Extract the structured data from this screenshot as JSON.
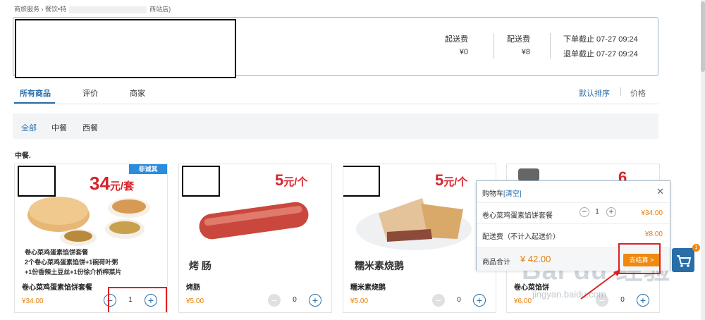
{
  "breadcrumb": {
    "part1": "商旅服务 › 餐饮•特",
    "part2": "西站店)"
  },
  "shop": {
    "fees": [
      {
        "label": "起送费",
        "value": "¥0"
      },
      {
        "label": "配送费",
        "value": "¥8"
      }
    ],
    "deadlines": [
      {
        "label": "下单截止 07-27 09:24"
      },
      {
        "label": "退单截止 07-27 09:24"
      }
    ]
  },
  "tabs": [
    {
      "label": "所有商品"
    },
    {
      "label": "评价"
    },
    {
      "label": "商家"
    }
  ],
  "sort": {
    "default": "默认排序",
    "price": "价格"
  },
  "filters": [
    {
      "label": "全部"
    },
    {
      "label": "中餐"
    },
    {
      "label": "西餐"
    }
  ],
  "section_title": "中餐.",
  "products": [
    {
      "name": "卷心菜鸡蛋素馅饼套餐",
      "price": "¥34.00",
      "qty": "1",
      "promo_num": "34",
      "promo_unit": "元/套",
      "badge": "非诚其",
      "desc": [
        "卷心菜鸡蛋素馅饼套餐",
        "2个卷心菜鸡蛋素馅饼+1碗荷叶粥",
        "+1份香辣土豆丝+1份徐介桥榨菜片"
      ]
    },
    {
      "name": "烤肠",
      "price": "¥5.00",
      "qty": "0",
      "promo_num": "5",
      "promo_unit": "元/个",
      "overlay": "烤 肠"
    },
    {
      "name": "糯米素烧鹅",
      "price": "¥5.00",
      "qty": "0",
      "promo_num": "5",
      "promo_unit": "元/个",
      "overlay": "糯米素烧鹅"
    },
    {
      "name": "卷心菜馅饼",
      "price": "¥6.00",
      "qty": "0",
      "promo_num": "6"
    }
  ],
  "cart": {
    "title": "购物车",
    "clear": "[清空]",
    "items": [
      {
        "name": "卷心菜鸡蛋素馅饼套餐",
        "qty": "1",
        "price": "¥34.00"
      }
    ],
    "delivery": {
      "label": "配送费（不计入起送价）",
      "price": "¥8.00"
    },
    "total_label": "商品合计",
    "total": "¥ 42.00",
    "checkout": "去结算 >",
    "badge": "1"
  },
  "watermark": {
    "main": "Bai du 经验",
    "sub": "jingyan.baidu.com"
  },
  "colors": {
    "accent": "#2a6ea8",
    "price": "#e8800c",
    "checkout": "#f0890f",
    "annotation": "#e02020"
  }
}
